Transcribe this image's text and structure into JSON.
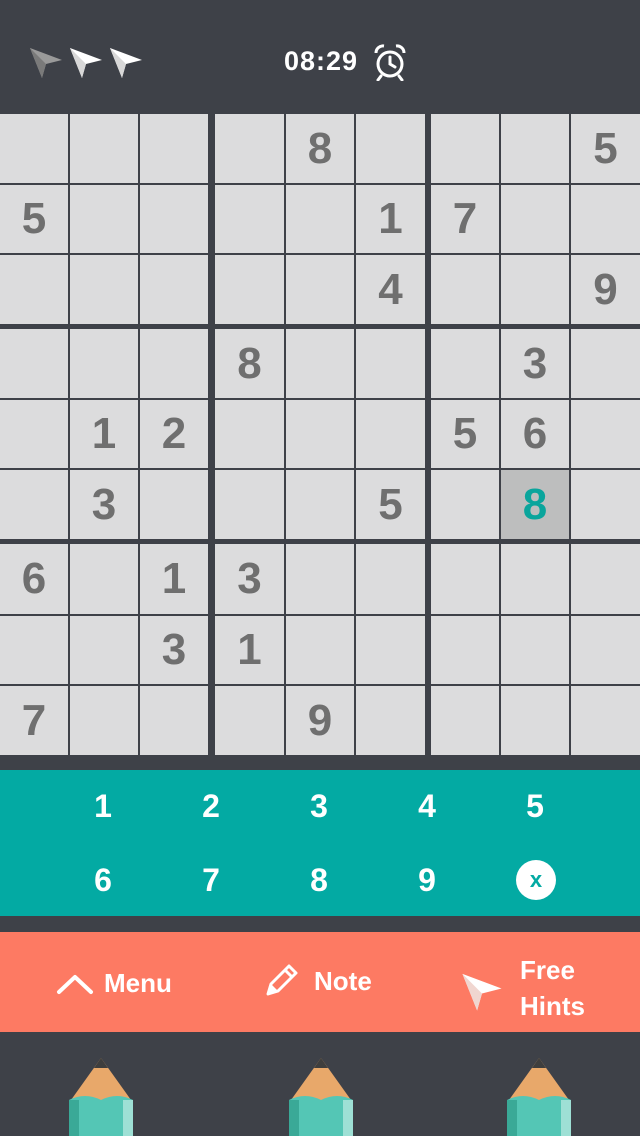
{
  "header": {
    "timer": "08:29",
    "hint_icons": [
      "paper-plane-icon-used",
      "paper-plane-icon",
      "paper-plane-icon"
    ],
    "alarm_icon": "alarm-clock-icon"
  },
  "board": {
    "grid": [
      [
        "",
        "",
        "",
        "",
        "8",
        "",
        "",
        "",
        "5"
      ],
      [
        "5",
        "",
        "",
        "",
        "",
        "1",
        "7",
        "",
        ""
      ],
      [
        "",
        "",
        "",
        "",
        "",
        "4",
        "",
        "",
        "9"
      ],
      [
        "",
        "",
        "",
        "8",
        "",
        "",
        "",
        "3",
        ""
      ],
      [
        "",
        "1",
        "2",
        "",
        "",
        "",
        "5",
        "6",
        ""
      ],
      [
        "",
        "3",
        "",
        "",
        "",
        "5",
        "",
        "8",
        ""
      ],
      [
        "6",
        "",
        "1",
        "3",
        "",
        "",
        "",
        "",
        ""
      ],
      [
        "",
        "",
        "3",
        "1",
        "",
        "",
        "",
        "",
        ""
      ],
      [
        "7",
        "",
        "",
        "",
        "9",
        "",
        "",
        "",
        ""
      ]
    ],
    "selected": [
      5,
      7
    ]
  },
  "numpad": {
    "keys": [
      "1",
      "2",
      "3",
      "4",
      "5",
      "6",
      "7",
      "8",
      "9"
    ],
    "erase_label": "x"
  },
  "actions": {
    "menu_label": "Menu",
    "note_label": "Note",
    "hints_label_line1": "Free",
    "hints_label_line2": "Hints"
  },
  "colors": {
    "background": "#3e4148",
    "cell": "#dcdcdd",
    "selected_cell": "#bdbebe",
    "given_digit": "#6f6f6f",
    "selected_digit": "#0aa59c",
    "numpad": "#03aaa3",
    "actionbar": "#fd7a63"
  }
}
